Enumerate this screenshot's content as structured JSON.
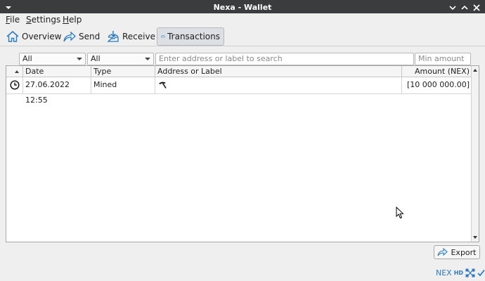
{
  "window": {
    "title": "Nexa - Wallet"
  },
  "menu": {
    "items": [
      {
        "label": "File",
        "mnemonic": "F",
        "rest": "ile"
      },
      {
        "label": "Settings",
        "mnemonic": "S",
        "rest": "ettings"
      },
      {
        "label": "Help",
        "mnemonic": "H",
        "rest": "elp"
      }
    ]
  },
  "toolbar": {
    "overview": "Overview",
    "send": "Send",
    "receive": "Receive",
    "transactions": "Transactions",
    "active": "transactions",
    "icons": [
      "home-icon",
      "send-arrow-icon",
      "receive-inbox-icon",
      "credit-card-icon"
    ],
    "accent": "#2f7bbd"
  },
  "filters": {
    "date": "All",
    "type": "All",
    "search_placeholder": "Enter address or label to search",
    "amount_placeholder": "Min amount"
  },
  "table": {
    "headers": {
      "status": "",
      "date": "Date",
      "type": "Type",
      "address": "Address or Label",
      "amount": "Amount (NEX)"
    },
    "sort_column": "status",
    "rows": [
      {
        "status_icon": "clock-icon",
        "date": "27.06.2022 12:55",
        "type": "Mined",
        "address_icon": "pickaxe-icon",
        "address": "",
        "amount": "[10 000 000.00]"
      }
    ]
  },
  "export": {
    "label": "Export",
    "icon": "export-arrow-icon"
  },
  "statusbar": {
    "unit": "NEX",
    "hd": "HD",
    "icons": [
      "network-icon",
      "synced-check-icon"
    ]
  }
}
